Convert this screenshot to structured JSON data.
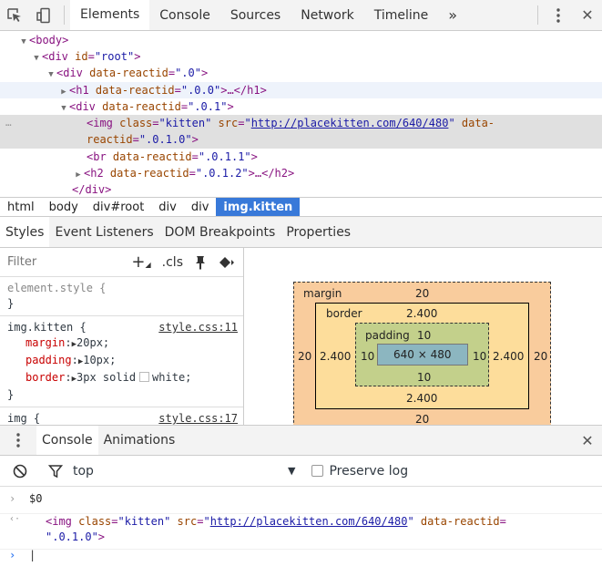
{
  "toolbar": {
    "tabs": [
      "Elements",
      "Console",
      "Sources",
      "Network",
      "Timeline"
    ],
    "more_label": "»",
    "menu_icon": "kebab-menu-icon",
    "close_label": "✕"
  },
  "tree": {
    "l1": {
      "tag_open": "<body>"
    },
    "l2": {
      "tag": "<div",
      "attr": "id",
      "val": "\"root\"",
      "close": ">"
    },
    "l3": {
      "tag": "<div",
      "attr": "data-reactid",
      "val": "\".0\"",
      "close": ">"
    },
    "l4": {
      "tag": "<h1",
      "attr": "data-reactid",
      "val": "\".0.0\"",
      "mid": ">…",
      "end": "</h1>"
    },
    "l5": {
      "tag": "<div",
      "attr": "data-reactid",
      "val": "\".0.1\"",
      "close": ">"
    },
    "l6": {
      "tag": "<img",
      "a1": "class",
      "v1": "\"kitten\"",
      "a2": "src",
      "q1": "\"",
      "url": "http://placekitten.com/640/480",
      "q2": "\"",
      "a3": "data-",
      "a3b": "reactid",
      "v3": "\".0.1.0\"",
      "close": ">"
    },
    "l7": {
      "tag": "<br",
      "attr": "data-reactid",
      "val": "\".0.1.1\"",
      "close": ">"
    },
    "l8": {
      "tag": "<h2",
      "attr": "data-reactid",
      "val": "\".0.1.2\"",
      "mid": ">…",
      "end": "</h2>"
    },
    "l9": {
      "end": "</div>"
    },
    "dots": "…"
  },
  "breadcrumbs": [
    "html",
    "body",
    "div#root",
    "div",
    "div",
    "img.kitten"
  ],
  "subtabs": [
    "Styles",
    "Event Listeners",
    "DOM Breakpoints",
    "Properties"
  ],
  "styles": {
    "filter_placeholder": "Filter",
    "add_label": "+",
    "cls_label": ".cls",
    "element_style": {
      "selector": "element.style {",
      "close": "}"
    },
    "kitten_rule": {
      "selector": "img.kitten {",
      "source": "style.css:11",
      "props": [
        {
          "name": "margin",
          "value": "20px;"
        },
        {
          "name": "padding",
          "value": "10px;"
        },
        {
          "name": "border",
          "value": "3px solid",
          "color": "white;"
        }
      ],
      "close": "}"
    },
    "img_rule": {
      "selector": "img {",
      "source": "style.css:17"
    }
  },
  "box_model": {
    "margin_label": "margin",
    "margin_top": "20",
    "margin_bottom": "20",
    "margin_left": "20",
    "margin_right": "20",
    "border_label": "border",
    "border_top": "2.400",
    "border_bottom": "2.400",
    "border_left": "2.400",
    "border_right": "2.400",
    "padding_label": "padding",
    "padding_top": "10",
    "padding_bottom": "10",
    "padding_left": "10",
    "padding_right": "10",
    "content": "640 × 480"
  },
  "drawer": {
    "tabs": [
      "Console",
      "Animations"
    ],
    "close_label": "✕",
    "context": "top",
    "preserve_log": "Preserve log"
  },
  "console": {
    "input_prompt": "›",
    "line1": "$0",
    "result_prompt": "‹·",
    "result": {
      "tag": "<img",
      "a1": "class",
      "v1": "\"kitten\"",
      "a2": "src",
      "q1": "\"",
      "url": "http://placekitten.com/640/480",
      "q2": "\"",
      "a3": "data-reactid",
      "eq": "=",
      "v3": "\".0.1.0\"",
      "close": ">"
    },
    "cursor_prompt": "›"
  }
}
